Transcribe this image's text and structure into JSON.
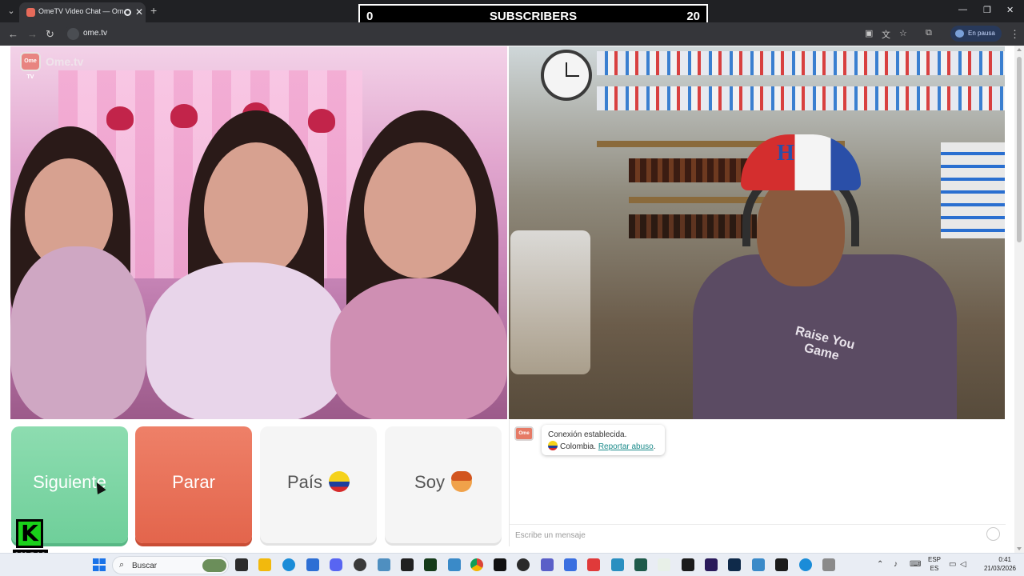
{
  "browser": {
    "tab_title": "OmeTV Video Chat — Ome",
    "tab_close": "✕",
    "new_tab": "+",
    "url": "ome.tv",
    "profile_status": "En pausa"
  },
  "overlay": {
    "left_count": "0",
    "label": "SUBSCRIBERS",
    "right_count": "20"
  },
  "page": {
    "logo_badge": "Ome TV",
    "logo_text": "Ome.tv",
    "left_video_alt": "Remote video feed",
    "right_video_alt": "Local camera feed",
    "cap_letter": "H",
    "shirt_text": "Raise You Game"
  },
  "buttons": {
    "next": "Siguiente",
    "stop": "Parar",
    "country": "País",
    "gender": "Soy"
  },
  "chat": {
    "avatar_label": "Ome TV",
    "status_line": "Conexión establecida.",
    "country_name": "Colombia.",
    "report_link": "Reportar abuso",
    "report_suffix": ".",
    "input_placeholder": "Escribe un mensaje"
  },
  "streamer": {
    "logo_letter": "K",
    "logo_text": "KICK"
  },
  "taskbar": {
    "search_placeholder": "Buscar",
    "lang_primary": "ESP",
    "lang_secondary": "ES",
    "time": "0:41",
    "date": "21/03/2026"
  },
  "colors": {
    "next_button": "#6fcf9a",
    "stop_button": "#e3654c",
    "kick_green": "#1ad11a",
    "report_link": "#1a8a8a"
  }
}
